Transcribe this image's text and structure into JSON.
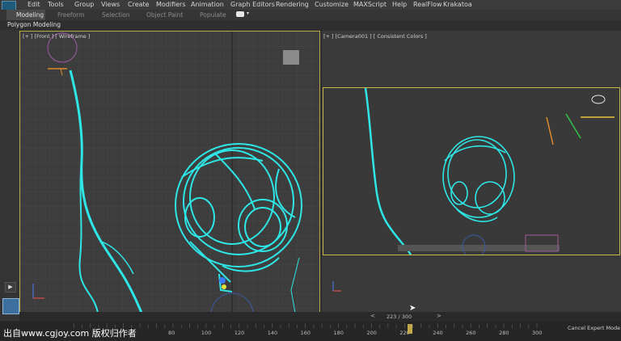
{
  "menu": [
    "Edit",
    "Tools",
    "Group",
    "Views",
    "Create",
    "Modifiers",
    "Animation",
    "Graph Editors",
    "Rendering",
    "Customize",
    "MAXScript",
    "Help",
    "RealFlow",
    "Krakatoa"
  ],
  "ribbon_tabs": [
    "Modeling",
    "Freeform",
    "Selection",
    "Object Paint",
    "Populate"
  ],
  "active_ribbon_tab": "Modeling",
  "subbar_label": "Polygon Modeling",
  "viewport_front_label": "[+ ] [Front ] [ Wireframe ]",
  "viewport_camera_label": "[+ ] [Camera001 ] [ Consistent Colors ]",
  "frame_counter": "223 / 300",
  "timeline_ticks": [
    "80",
    "100",
    "120",
    "140",
    "160",
    "180",
    "200",
    "220",
    "240",
    "260",
    "280",
    "300"
  ],
  "timeline_current_frame": 223,
  "timeline_max_frame": 300,
  "status_text": "Cancel Expert Mode",
  "watermark": "出自www.cgjoy.com 版权归作者",
  "colors": {
    "wireframe": "#2ee6e6",
    "active_border": "#c9b84c",
    "timeline_slider": "#c2a84a"
  }
}
